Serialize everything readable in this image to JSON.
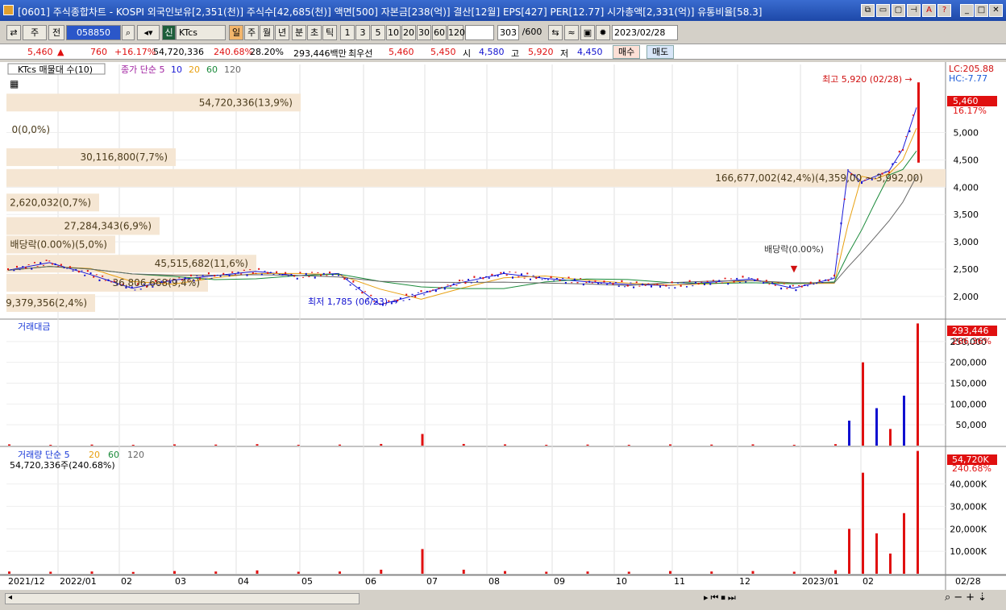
{
  "title": "[0601] 주식종합차트 - KOSPI 외국인보유[2,351(천)] 주식수[42,685(천)] 액면[500] 자본금[238(억)] 결산[12월] EPS[427] PER[12.77] 시가총액[2,331(억)] 유통비율[58.3]",
  "toolbar": {
    "main_button": "주",
    "prev_label": "전",
    "code": "058850",
    "stock_badge": "신",
    "stock_name": "KTcs",
    "periods": [
      "일",
      "주",
      "월",
      "년",
      "분",
      "초",
      "틱"
    ],
    "intervals": [
      "1",
      "3",
      "5",
      "10",
      "20",
      "30",
      "60",
      "120"
    ],
    "count": "303",
    "count_max": "/600",
    "date": "2023/02/28"
  },
  "quote": {
    "price": "5,460",
    "change": "760",
    "change_pct": "+16.17%",
    "volume": "54,720,336",
    "volume_ratio": "240.68%",
    "turnover": "28.20%",
    "amount": "293,446백만",
    "bid_label": "최우선",
    "bid1": "5,460",
    "bid2": "5,450",
    "open_label": "시",
    "open": "4,580",
    "high_label": "고",
    "high": "5,920",
    "low_label": "저",
    "low": "4,450",
    "buy": "매수",
    "sell": "매도"
  },
  "colors": {
    "up": "#e01010",
    "down": "#1010d0",
    "volprofile": "#f5e6d3",
    "ma5": "#1a1ad8",
    "ma10": "#e8a010",
    "ma20": "#1a8a3a",
    "ma60": "#666666"
  },
  "chart_data": [
    {
      "type": "line",
      "title": "KTcs 매물대 수(10)",
      "legend": [
        "종가 단순 5",
        "10",
        "20",
        "60",
        "120"
      ],
      "ylim": [
        1600,
        6100
      ],
      "yticks": [
        "2,000",
        "2,500",
        "3,000",
        "3,500",
        "4,000",
        "4,500",
        "5,000"
      ],
      "right_labels": [
        "LC:205.88",
        "HC:-7.77",
        "5,460",
        "16.17%"
      ],
      "annotations": [
        "최고 5,920 (02/28)",
        "최저 1,785 (06/23)",
        "배당락(0.00%)",
        "배당락(0.00%)"
      ],
      "volume_profile": [
        {
          "label": "54,720,336(13,9%)",
          "price": 5550
        },
        {
          "label": "0(0,0%)",
          "price": 5050
        },
        {
          "label": "30,116,800(7,7%)",
          "price": 4550
        },
        {
          "label": "166,677,002(42,4%)(4,359,00 ~ 3,992,00)",
          "price": 4170
        },
        {
          "label": "2,620,032(0,7%)",
          "price": 3720
        },
        {
          "label": "27,284,343(6,9%)",
          "price": 3290
        },
        {
          "label": "배당락(0.00%)(5,0%)",
          "price": 2950
        },
        {
          "label": "45,515,682(11,6%)",
          "price": 2600
        },
        {
          "label": "36,806,668(9,4%)",
          "price": 2250
        },
        {
          "label": "9,379,356(2,4%)",
          "price": 1880
        }
      ],
      "close": [
        2480,
        2620,
        2400,
        2150,
        2300,
        2380,
        2460,
        2380,
        2420,
        1850,
        2050,
        2260,
        2420,
        2330,
        2270,
        2220,
        2200,
        2260,
        2320,
        2150,
        2330,
        4300,
        4100,
        4200,
        4300,
        4700,
        5460
      ]
    },
    {
      "type": "bar",
      "title": "거래대금",
      "ylim": [
        0,
        300000
      ],
      "yticks": [
        "50,000",
        "100,000",
        "150,000",
        "200,000",
        "250,000"
      ],
      "right_labels": [
        "293,446",
        "286.36%"
      ],
      "values": [
        3000,
        2000,
        2500,
        2000,
        3000,
        2500,
        3500,
        2000,
        2500,
        4000,
        28000,
        4000,
        3000,
        2000,
        2500,
        2000,
        3000,
        2500,
        3000,
        2000,
        3500,
        60000,
        200000,
        90000,
        40000,
        120000,
        293446
      ]
    },
    {
      "type": "bar",
      "title": "거래량 단순 5",
      "legend": [
        "20",
        "60",
        "120"
      ],
      "header": "54,720,336주(240.68%)",
      "ylim": [
        0,
        56000
      ],
      "yticks": [
        "10,000K",
        "20,000K",
        "30,000K",
        "40,000K"
      ],
      "right_labels": [
        "54,720K",
        "240.68%"
      ],
      "values": [
        1000,
        900,
        1000,
        800,
        1200,
        1000,
        1500,
        900,
        1000,
        1800,
        11000,
        1800,
        1200,
        900,
        1000,
        900,
        1200,
        1000,
        1200,
        900,
        1600,
        20000,
        45000,
        18000,
        9000,
        27000,
        54720
      ]
    }
  ],
  "xaxis": [
    "2021/12",
    "2022/01",
    "02",
    "03",
    "04",
    "05",
    "06",
    "07",
    "08",
    "09",
    "10",
    "11",
    "12",
    "2023/01",
    "02",
    "02/28"
  ]
}
